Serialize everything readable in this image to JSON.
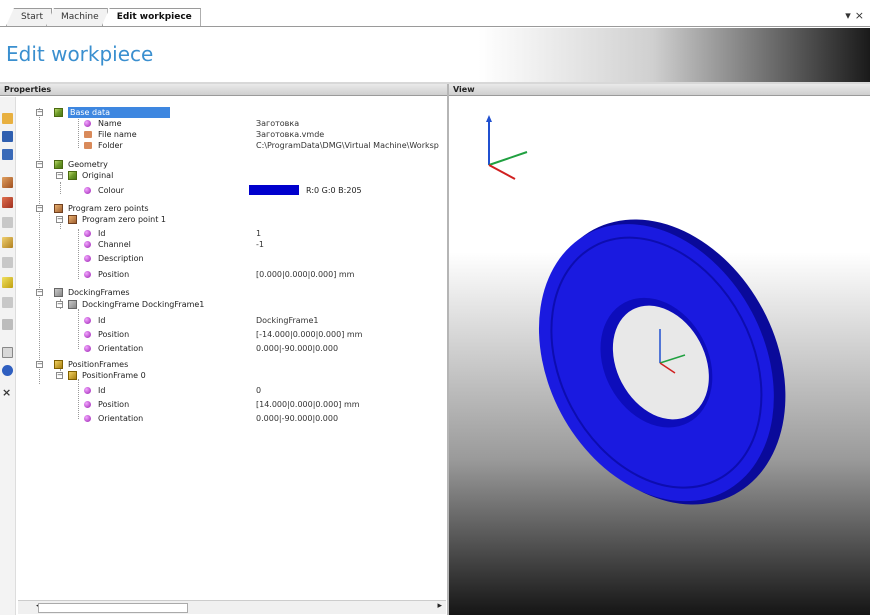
{
  "tabs": [
    {
      "label": "Start"
    },
    {
      "label": "Machine"
    },
    {
      "label": "Edit workpiece"
    }
  ],
  "window_controls": {
    "dropdown": "▾",
    "close": "×"
  },
  "header": {
    "title": "Edit workpiece"
  },
  "panels": {
    "properties": "Properties",
    "view": "View"
  },
  "toolbar_icons": [
    "open-icon",
    "save-icon",
    "save-as-icon",
    "cube-icon",
    "cube-red-icon",
    "cube-grey-icon",
    "cube-add-icon",
    "cube-grey2-icon",
    "cube-yellow-icon",
    "cube-grey3-icon",
    "cube-grey4-icon",
    "export-icon",
    "info-icon",
    "delete-icon"
  ],
  "tree": {
    "base_data": {
      "label": "Base data"
    },
    "name": {
      "label": "Name",
      "value": "Заготовка"
    },
    "file_name": {
      "label": "File name",
      "value": "Заготовка.vmde"
    },
    "folder": {
      "label": "Folder",
      "value": "C:\\ProgramData\\DMG\\Virtual Machine\\Worksp"
    },
    "geometry": {
      "label": "Geometry"
    },
    "original": {
      "label": "Original"
    },
    "colour": {
      "label": "Colour",
      "value": "R:0 G:0 B:205",
      "swatch": "#0000cd"
    },
    "program_zero_points": {
      "label": "Program zero points"
    },
    "program_zero_point_1": {
      "label": "Program zero point 1"
    },
    "pzp_id": {
      "label": "Id",
      "value": "1"
    },
    "pzp_channel": {
      "label": "Channel",
      "value": "-1"
    },
    "pzp_description": {
      "label": "Description",
      "value": ""
    },
    "pzp_position": {
      "label": "Position",
      "value": "[0.000|0.000|0.000] mm"
    },
    "docking_frames": {
      "label": "DockingFrames"
    },
    "docking_frame_1": {
      "label": "DockingFrame DockingFrame1"
    },
    "df_id": {
      "label": "Id",
      "value": "DockingFrame1"
    },
    "df_position": {
      "label": "Position",
      "value": "[-14.000|0.000|0.000] mm"
    },
    "df_orientation": {
      "label": "Orientation",
      "value": "0.000|-90.000|0.000"
    },
    "position_frames": {
      "label": "PositionFrames"
    },
    "position_frame_0": {
      "label": "PositionFrame 0"
    },
    "pf_id": {
      "label": "Id",
      "value": "0"
    },
    "pf_position": {
      "label": "Position",
      "value": "[14.000|0.000|0.000] mm"
    },
    "pf_orientation": {
      "label": "Orientation",
      "value": "0.000|-90.000|0.000"
    }
  },
  "colors": {
    "accent": "#3a8fcf",
    "selection": "#3e87e0",
    "workpiece": "#1a1ae0"
  }
}
